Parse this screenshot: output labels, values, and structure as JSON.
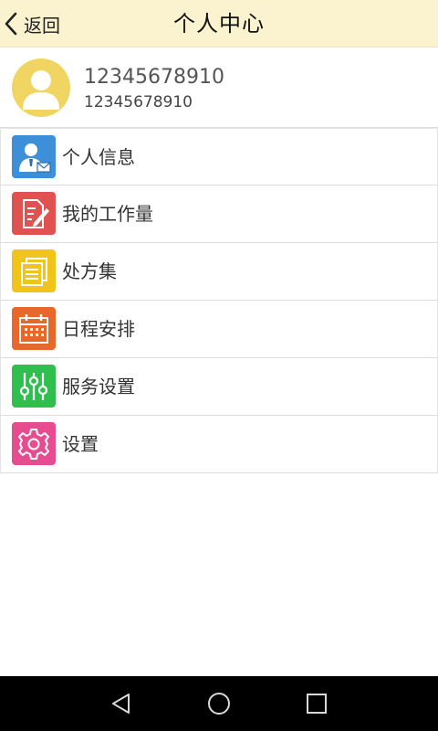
{
  "header": {
    "back_label": "返回",
    "title": "个人中心"
  },
  "profile": {
    "name": "12345678910",
    "phone": "12345678910"
  },
  "menu": {
    "items": [
      {
        "label": "个人信息",
        "icon": "contact-card-icon",
        "color": "#3d8fd8"
      },
      {
        "label": "我的工作量",
        "icon": "edit-document-icon",
        "color": "#e0524f"
      },
      {
        "label": "处方集",
        "icon": "documents-stack-icon",
        "color": "#f0c419"
      },
      {
        "label": "日程安排",
        "icon": "calendar-icon",
        "color": "#e8682c"
      },
      {
        "label": "服务设置",
        "icon": "sliders-icon",
        "color": "#2fbf4f"
      },
      {
        "label": "设置",
        "icon": "gear-icon",
        "color": "#e64c8f"
      }
    ]
  },
  "colors": {
    "header_bg": "#fbf3cf",
    "avatar_bg": "#f0d562",
    "navbar_bg": "#000000"
  },
  "navbar": {
    "icons": [
      "back-triangle-icon",
      "home-circle-icon",
      "recents-square-icon"
    ]
  }
}
